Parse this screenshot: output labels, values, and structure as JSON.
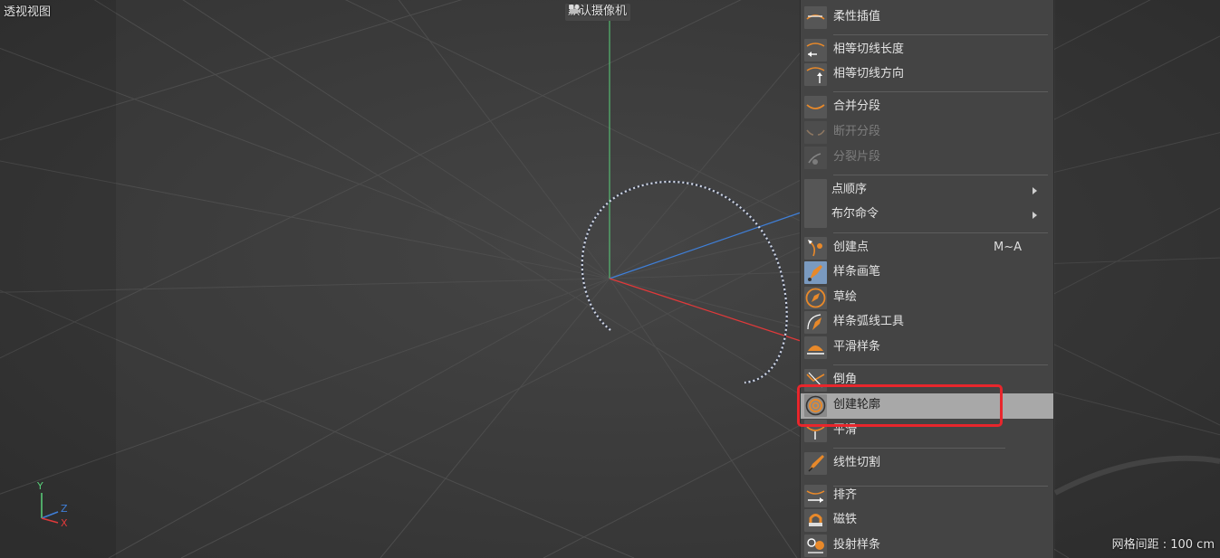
{
  "viewport": {
    "view_title": "透视视图",
    "camera_label": "默认摄像机",
    "grid_spacing": "网格间距 : 100 cm",
    "axes": {
      "y": "Y",
      "z": "Z",
      "x": "X"
    },
    "colors": {
      "x_axis": "#e0393a",
      "y_axis": "#5ad17a",
      "z_axis": "#3f7fd8",
      "background": "#3a3a3a"
    }
  },
  "menu": {
    "items": [
      {
        "label": "柔性插值",
        "icon": "soft-interpolation-icon",
        "state": "normal"
      },
      {
        "label": "相等切线长度",
        "icon": "equal-tangent-length-icon",
        "state": "normal"
      },
      {
        "label": "相等切线方向",
        "icon": "equal-tangent-direction-icon",
        "state": "normal"
      },
      {
        "label": "合并分段",
        "icon": "join-segment-icon",
        "state": "normal"
      },
      {
        "label": "断开分段",
        "icon": "break-segment-icon",
        "state": "disabled"
      },
      {
        "label": "分裂片段",
        "icon": "explode-segments-icon",
        "state": "disabled"
      },
      {
        "label": "点顺序",
        "state": "submenu"
      },
      {
        "label": "布尔命令",
        "state": "submenu"
      },
      {
        "label": "创建点",
        "icon": "create-point-icon",
        "shortcut": "M~A",
        "state": "normal"
      },
      {
        "label": "样条画笔",
        "icon": "spline-pen-icon",
        "state": "normal"
      },
      {
        "label": "草绘",
        "icon": "sketch-icon",
        "state": "normal"
      },
      {
        "label": "样条弧线工具",
        "icon": "spline-arc-tool-icon",
        "state": "normal"
      },
      {
        "label": "平滑样条",
        "icon": "smooth-spline-icon",
        "state": "normal"
      },
      {
        "label": "倒角",
        "icon": "chamfer-icon",
        "state": "normal"
      },
      {
        "label": "创建轮廓",
        "icon": "create-outline-icon",
        "state": "highlighted"
      },
      {
        "label": "平滑",
        "icon": "smooth-icon",
        "state": "normal"
      },
      {
        "label": "线性切割",
        "icon": "line-cut-icon",
        "state": "normal"
      },
      {
        "label": "排齐",
        "icon": "line-up-icon",
        "state": "normal"
      },
      {
        "label": "磁铁",
        "icon": "magnet-icon",
        "state": "normal"
      },
      {
        "label": "投射样条",
        "icon": "project-spline-icon",
        "state": "normal"
      }
    ],
    "colors": {
      "highlight": "#a8a8a8",
      "callout_border": "#e8262c",
      "icon_accent": "#e8892a"
    }
  }
}
